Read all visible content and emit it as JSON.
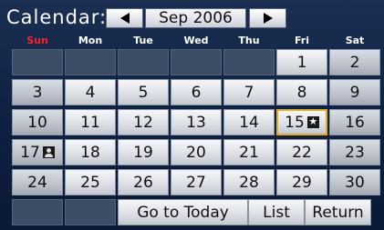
{
  "header": {
    "title": "Calendar:",
    "month_label": "Sep 2006",
    "prev_icon": "left-triangle-icon",
    "next_icon": "right-triangle-icon"
  },
  "weekdays": [
    {
      "label": "Sun",
      "color": "#ff2020"
    },
    {
      "label": "Mon",
      "color": "#ffffff"
    },
    {
      "label": "Tue",
      "color": "#ffffff"
    },
    {
      "label": "Wed",
      "color": "#ffffff"
    },
    {
      "label": "Thu",
      "color": "#ffffff"
    },
    {
      "label": "Fri",
      "color": "#ffffff"
    },
    {
      "label": "Sat",
      "color": "#ffffff"
    }
  ],
  "weeks": [
    [
      "",
      "",
      "",
      "",
      "",
      "1",
      "2"
    ],
    [
      "3",
      "4",
      "5",
      "6",
      "7",
      "8",
      "9"
    ],
    [
      "10",
      "11",
      "12",
      "13",
      "14",
      "15",
      "16"
    ],
    [
      "17",
      "18",
      "19",
      "20",
      "21",
      "22",
      "23"
    ],
    [
      "24",
      "25",
      "26",
      "27",
      "28",
      "29",
      "30"
    ]
  ],
  "selected_day": "15",
  "day_icons": {
    "15": "star-icon",
    "17": "person-icon"
  },
  "footer": {
    "today_label": "Go to Today",
    "list_label": "List",
    "return_label": "Return"
  },
  "colors": {
    "selection_border": "#e8a91c",
    "sunday_header": "#ff2020"
  }
}
